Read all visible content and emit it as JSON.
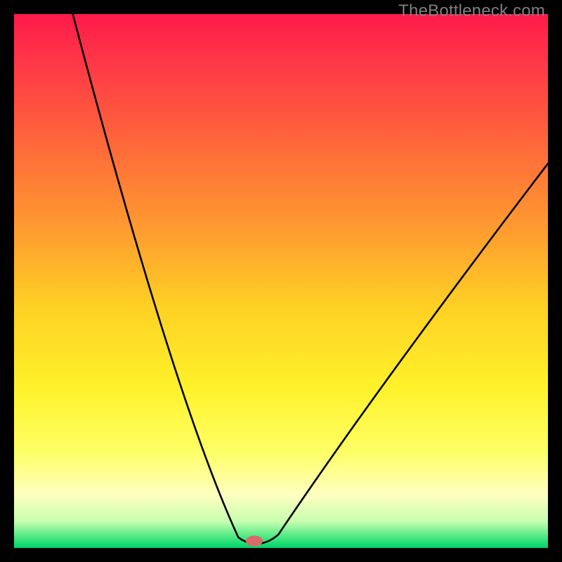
{
  "watermark": "TheBottleneck.com",
  "chart_data": {
    "type": "line",
    "title": "",
    "xlabel": "",
    "ylabel": "",
    "xlim": [
      0,
      100
    ],
    "ylim": [
      0,
      100
    ],
    "background_gradient": {
      "stops": [
        {
          "offset": 0.0,
          "color": "#ff1a4b"
        },
        {
          "offset": 0.1,
          "color": "#ff3a46"
        },
        {
          "offset": 0.25,
          "color": "#ff6a3a"
        },
        {
          "offset": 0.4,
          "color": "#ff9a30"
        },
        {
          "offset": 0.55,
          "color": "#ffd124"
        },
        {
          "offset": 0.7,
          "color": "#fff22a"
        },
        {
          "offset": 0.82,
          "color": "#ffff66"
        },
        {
          "offset": 0.9,
          "color": "#ffffc0"
        },
        {
          "offset": 0.95,
          "color": "#c8ffb0"
        },
        {
          "offset": 0.985,
          "color": "#35e37a"
        },
        {
          "offset": 1.0,
          "color": "#00d36a"
        }
      ]
    },
    "curve": {
      "left_start": {
        "x": 11.0,
        "y": 100.0
      },
      "left_ctrl": {
        "x": 30.0,
        "y": 28.0
      },
      "valley_in": {
        "x": 42.0,
        "y": 2.0
      },
      "valley_flat_a": {
        "x": 43.5,
        "y": 0.8
      },
      "valley_flat_b": {
        "x": 47.5,
        "y": 0.8
      },
      "valley_out": {
        "x": 49.5,
        "y": 2.5
      },
      "right_ctrl": {
        "x": 68.0,
        "y": 30.0
      },
      "right_end": {
        "x": 100.0,
        "y": 72.0
      }
    },
    "marker": {
      "x": 45.0,
      "y": 1.3,
      "color": "#d86a6a",
      "rx": 1.6,
      "ry": 1.0
    },
    "line_color": "#000000",
    "line_width": 2.6
  }
}
